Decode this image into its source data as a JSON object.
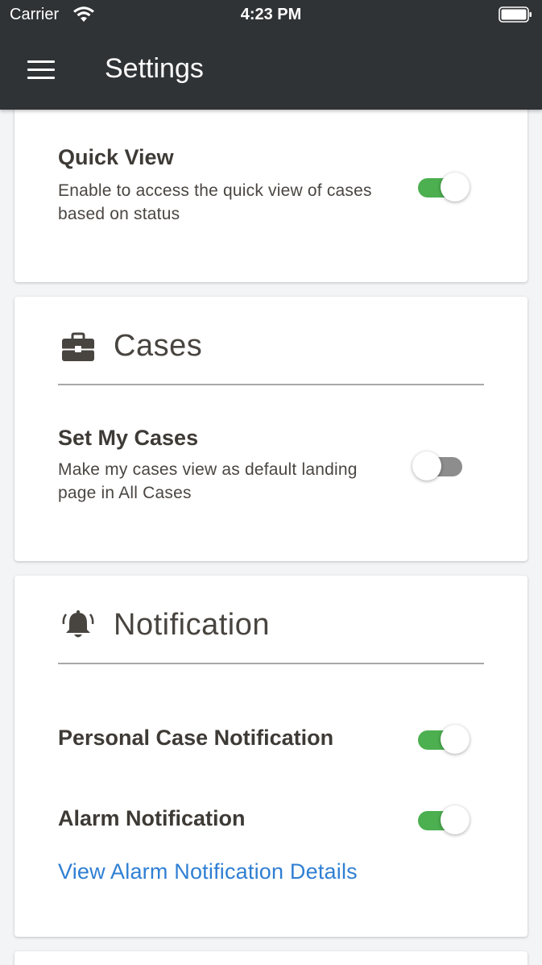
{
  "status_bar": {
    "carrier": "Carrier",
    "time": "4:23 PM"
  },
  "header": {
    "title": "Settings",
    "menu_icon": "hamburger-menu-icon"
  },
  "quick_view": {
    "title": "Quick View",
    "description": "Enable to access the quick view of cases based on status",
    "enabled": true
  },
  "cases": {
    "section_title": "Cases",
    "icon": "briefcase-icon",
    "set_my_cases": {
      "title": "Set My Cases",
      "description": "Make my cases view as default landing page in All Cases",
      "enabled": false
    }
  },
  "notification": {
    "section_title": "Notification",
    "icon": "bell-icon",
    "personal_case": {
      "title": "Personal Case Notification",
      "enabled": true
    },
    "alarm": {
      "title": "Alarm Notification",
      "enabled": true
    },
    "details_link": "View Alarm Notification Details"
  },
  "colors": {
    "header_bg": "#303336",
    "toggle_on": "#4caf50",
    "toggle_off": "#8d8d8d",
    "link": "#2f7fd3",
    "page_bg": "#f3f4f6"
  }
}
